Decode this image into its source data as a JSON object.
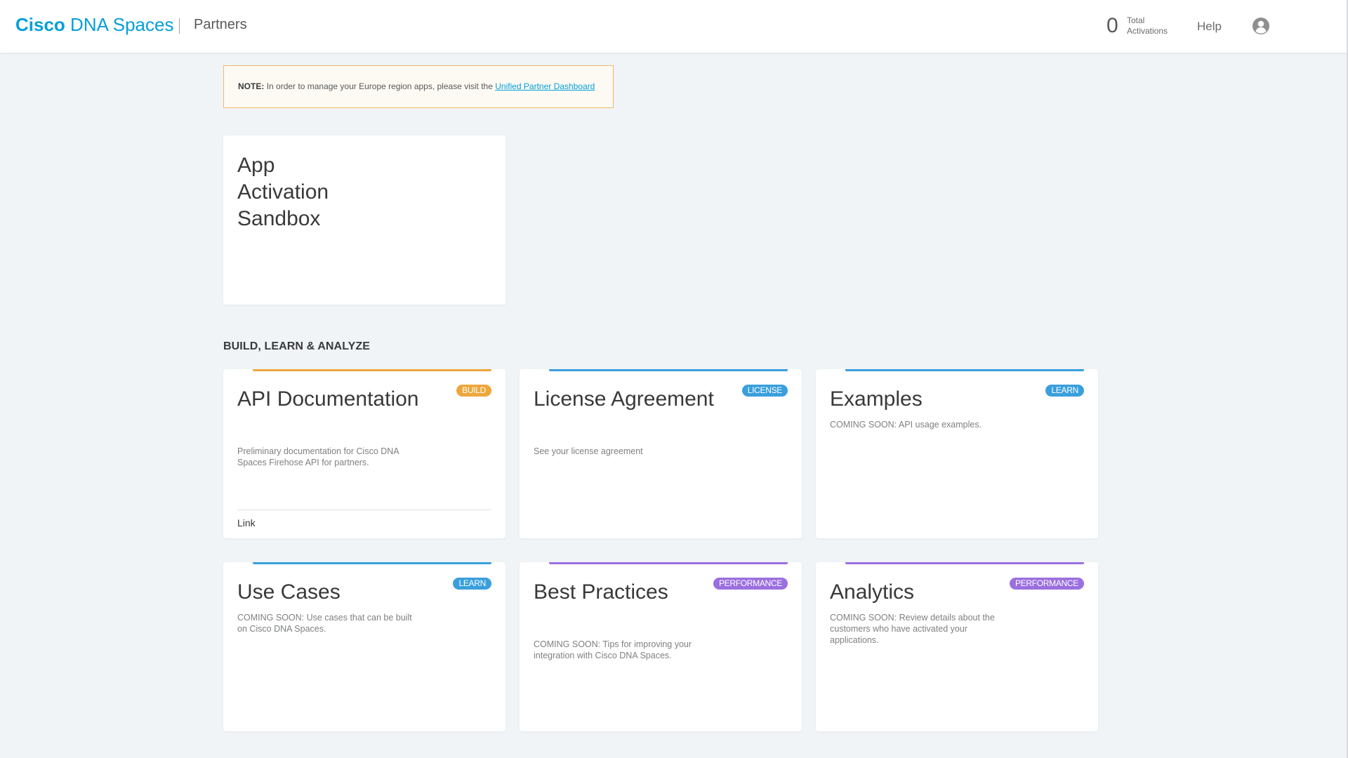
{
  "header": {
    "brand_cisco": "Cisco",
    "brand_product": "DNA Spaces",
    "section": "Partners",
    "activations_count": "0",
    "activations_label_line1": "Total",
    "activations_label_line2": "Activations",
    "help": "Help",
    "avatar_icon": "user-circle-icon"
  },
  "note": {
    "label": "NOTE:",
    "text": "In order to manage your Europe region apps, please visit the",
    "link": "Unified Partner Dashboard"
  },
  "sandbox": {
    "title": "App Activation Sandbox"
  },
  "section_heading": "BUILD, LEARN & ANALYZE",
  "colors": {
    "brand": "#049fd9",
    "build": "#eda73c",
    "license": "#3a9fdc",
    "learn": "#3a9fdc",
    "performance": "#9b6fe0"
  },
  "cards": [
    {
      "title": "API Documentation",
      "badge": "BUILD",
      "description": "Preliminary documentation for Cisco DNA Spaces Firehose API for partners.",
      "link": "Link"
    },
    {
      "title": "License Agreement",
      "badge": "LICENSE",
      "description": "See your license agreement"
    },
    {
      "title": "Examples",
      "badge": "LEARN",
      "description": "COMING SOON: API usage examples."
    },
    {
      "title": "Use Cases",
      "badge": "LEARN",
      "description": "COMING SOON: Use cases that can be built on Cisco DNA Spaces."
    },
    {
      "title": "Best Practices",
      "badge": "PERFORMANCE",
      "description": "COMING SOON: Tips for improving your integration with Cisco DNA Spaces."
    },
    {
      "title": "Analytics",
      "badge": "PERFORMANCE",
      "description": "COMING SOON: Review details about the customers who have activated your applications."
    }
  ]
}
